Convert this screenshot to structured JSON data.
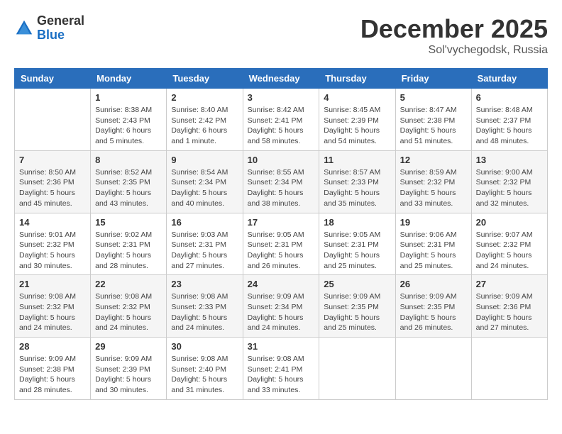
{
  "logo": {
    "general": "General",
    "blue": "Blue"
  },
  "header": {
    "month": "December 2025",
    "location": "Sol'vychegodsk, Russia"
  },
  "weekdays": [
    "Sunday",
    "Monday",
    "Tuesday",
    "Wednesday",
    "Thursday",
    "Friday",
    "Saturday"
  ],
  "weeks": [
    [
      {
        "day": "",
        "info": ""
      },
      {
        "day": "1",
        "info": "Sunrise: 8:38 AM\nSunset: 2:43 PM\nDaylight: 6 hours\nand 5 minutes."
      },
      {
        "day": "2",
        "info": "Sunrise: 8:40 AM\nSunset: 2:42 PM\nDaylight: 6 hours\nand 1 minute."
      },
      {
        "day": "3",
        "info": "Sunrise: 8:42 AM\nSunset: 2:41 PM\nDaylight: 5 hours\nand 58 minutes."
      },
      {
        "day": "4",
        "info": "Sunrise: 8:45 AM\nSunset: 2:39 PM\nDaylight: 5 hours\nand 54 minutes."
      },
      {
        "day": "5",
        "info": "Sunrise: 8:47 AM\nSunset: 2:38 PM\nDaylight: 5 hours\nand 51 minutes."
      },
      {
        "day": "6",
        "info": "Sunrise: 8:48 AM\nSunset: 2:37 PM\nDaylight: 5 hours\nand 48 minutes."
      }
    ],
    [
      {
        "day": "7",
        "info": "Sunrise: 8:50 AM\nSunset: 2:36 PM\nDaylight: 5 hours\nand 45 minutes."
      },
      {
        "day": "8",
        "info": "Sunrise: 8:52 AM\nSunset: 2:35 PM\nDaylight: 5 hours\nand 43 minutes."
      },
      {
        "day": "9",
        "info": "Sunrise: 8:54 AM\nSunset: 2:34 PM\nDaylight: 5 hours\nand 40 minutes."
      },
      {
        "day": "10",
        "info": "Sunrise: 8:55 AM\nSunset: 2:34 PM\nDaylight: 5 hours\nand 38 minutes."
      },
      {
        "day": "11",
        "info": "Sunrise: 8:57 AM\nSunset: 2:33 PM\nDaylight: 5 hours\nand 35 minutes."
      },
      {
        "day": "12",
        "info": "Sunrise: 8:59 AM\nSunset: 2:32 PM\nDaylight: 5 hours\nand 33 minutes."
      },
      {
        "day": "13",
        "info": "Sunrise: 9:00 AM\nSunset: 2:32 PM\nDaylight: 5 hours\nand 32 minutes."
      }
    ],
    [
      {
        "day": "14",
        "info": "Sunrise: 9:01 AM\nSunset: 2:32 PM\nDaylight: 5 hours\nand 30 minutes."
      },
      {
        "day": "15",
        "info": "Sunrise: 9:02 AM\nSunset: 2:31 PM\nDaylight: 5 hours\nand 28 minutes."
      },
      {
        "day": "16",
        "info": "Sunrise: 9:03 AM\nSunset: 2:31 PM\nDaylight: 5 hours\nand 27 minutes."
      },
      {
        "day": "17",
        "info": "Sunrise: 9:05 AM\nSunset: 2:31 PM\nDaylight: 5 hours\nand 26 minutes."
      },
      {
        "day": "18",
        "info": "Sunrise: 9:05 AM\nSunset: 2:31 PM\nDaylight: 5 hours\nand 25 minutes."
      },
      {
        "day": "19",
        "info": "Sunrise: 9:06 AM\nSunset: 2:31 PM\nDaylight: 5 hours\nand 25 minutes."
      },
      {
        "day": "20",
        "info": "Sunrise: 9:07 AM\nSunset: 2:32 PM\nDaylight: 5 hours\nand 24 minutes."
      }
    ],
    [
      {
        "day": "21",
        "info": "Sunrise: 9:08 AM\nSunset: 2:32 PM\nDaylight: 5 hours\nand 24 minutes."
      },
      {
        "day": "22",
        "info": "Sunrise: 9:08 AM\nSunset: 2:32 PM\nDaylight: 5 hours\nand 24 minutes."
      },
      {
        "day": "23",
        "info": "Sunrise: 9:08 AM\nSunset: 2:33 PM\nDaylight: 5 hours\nand 24 minutes."
      },
      {
        "day": "24",
        "info": "Sunrise: 9:09 AM\nSunset: 2:34 PM\nDaylight: 5 hours\nand 24 minutes."
      },
      {
        "day": "25",
        "info": "Sunrise: 9:09 AM\nSunset: 2:35 PM\nDaylight: 5 hours\nand 25 minutes."
      },
      {
        "day": "26",
        "info": "Sunrise: 9:09 AM\nSunset: 2:35 PM\nDaylight: 5 hours\nand 26 minutes."
      },
      {
        "day": "27",
        "info": "Sunrise: 9:09 AM\nSunset: 2:36 PM\nDaylight: 5 hours\nand 27 minutes."
      }
    ],
    [
      {
        "day": "28",
        "info": "Sunrise: 9:09 AM\nSunset: 2:38 PM\nDaylight: 5 hours\nand 28 minutes."
      },
      {
        "day": "29",
        "info": "Sunrise: 9:09 AM\nSunset: 2:39 PM\nDaylight: 5 hours\nand 30 minutes."
      },
      {
        "day": "30",
        "info": "Sunrise: 9:08 AM\nSunset: 2:40 PM\nDaylight: 5 hours\nand 31 minutes."
      },
      {
        "day": "31",
        "info": "Sunrise: 9:08 AM\nSunset: 2:41 PM\nDaylight: 5 hours\nand 33 minutes."
      },
      {
        "day": "",
        "info": ""
      },
      {
        "day": "",
        "info": ""
      },
      {
        "day": "",
        "info": ""
      }
    ]
  ]
}
